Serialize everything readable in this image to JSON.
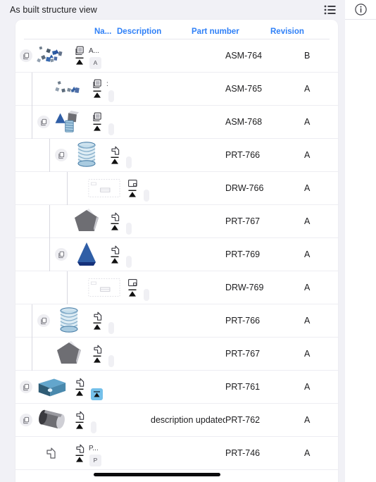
{
  "window": {
    "title": "As built structure view",
    "list_icon": "list-view-icon",
    "info_icon": "info-circle-icon"
  },
  "table": {
    "columns": [
      {
        "key": "name",
        "label": "Na..."
      },
      {
        "key": "desc",
        "label": "Description"
      },
      {
        "key": "part",
        "label": "Part number"
      },
      {
        "key": "revision",
        "label": "Revision"
      }
    ],
    "rows": [
      {
        "depth": 0,
        "thumb": "exploded-assembly-large",
        "type": "assembly-icon",
        "name": "A...",
        "badge": "A",
        "badge_highlight": false,
        "desc": "",
        "part": "ASM-764",
        "revision": "B",
        "expandable": true,
        "has_expand_toggle": true,
        "chevron": "chevron-down-icon"
      },
      {
        "depth": 1,
        "thumb": "exploded-assembly-small",
        "type": "assembly-icon",
        "name": ":",
        "badge": "",
        "badge_highlight": false,
        "desc": "",
        "part": "ASM-765",
        "revision": "A",
        "expandable": true,
        "has_expand_toggle": false,
        "chevron": "chevron-down-icon"
      },
      {
        "depth": 1,
        "thumb": "cone-box-coil-assembly",
        "type": "assembly-icon",
        "name": "",
        "badge": "",
        "badge_highlight": false,
        "desc": "",
        "part": "ASM-768",
        "revision": "A",
        "expandable": true,
        "has_expand_toggle": true,
        "chevron": "chevron-down-icon"
      },
      {
        "depth": 2,
        "thumb": "coil-spring",
        "type": "part-icon",
        "name": "",
        "badge": "",
        "badge_highlight": false,
        "desc": "",
        "part": "PRT-766",
        "revision": "A",
        "expandable": true,
        "has_expand_toggle": true,
        "chevron": "chevron-down-icon"
      },
      {
        "depth": 3,
        "thumb": "drawing-sheet",
        "type": "drawing-icon",
        "name": "",
        "badge": "",
        "badge_highlight": false,
        "desc": "",
        "part": "DRW-766",
        "revision": "A",
        "expandable": false,
        "has_expand_toggle": false,
        "chevron": ""
      },
      {
        "depth": 2,
        "thumb": "grey-pentagon-solid",
        "type": "part-icon",
        "name": "",
        "badge": "",
        "badge_highlight": false,
        "desc": "",
        "part": "PRT-767",
        "revision": "A",
        "expandable": false,
        "has_expand_toggle": false,
        "chevron": ""
      },
      {
        "depth": 2,
        "thumb": "blue-cone",
        "type": "part-icon",
        "name": "",
        "badge": "",
        "badge_highlight": false,
        "desc": "",
        "part": "PRT-769",
        "revision": "A",
        "expandable": true,
        "has_expand_toggle": true,
        "chevron": "chevron-down-icon"
      },
      {
        "depth": 3,
        "thumb": "drawing-sheet",
        "type": "drawing-icon",
        "name": "",
        "badge": "",
        "badge_highlight": false,
        "desc": "",
        "part": "DRW-769",
        "revision": "A",
        "expandable": false,
        "has_expand_toggle": false,
        "chevron": ""
      },
      {
        "depth": 1,
        "thumb": "coil-spring",
        "type": "part-icon",
        "name": "",
        "badge": "",
        "badge_highlight": false,
        "desc": "",
        "part": "PRT-766",
        "revision": "A",
        "expandable": false,
        "has_expand_toggle": true,
        "chevron": ""
      },
      {
        "depth": 1,
        "thumb": "grey-pentagon-solid",
        "type": "part-icon",
        "name": "",
        "badge": "",
        "badge_highlight": false,
        "desc": "",
        "part": "PRT-767",
        "revision": "A",
        "expandable": false,
        "has_expand_toggle": false,
        "chevron": ""
      },
      {
        "depth": 0,
        "thumb": "blue-block",
        "type": "part-icon",
        "name": "",
        "badge": "",
        "badge_highlight": true,
        "desc": "",
        "part": "PRT-761",
        "revision": "A",
        "expandable": false,
        "has_expand_toggle": true,
        "chevron": ""
      },
      {
        "depth": 0,
        "thumb": "grey-cylinder",
        "type": "part-icon",
        "name": "",
        "badge": "",
        "badge_highlight": false,
        "desc": "description updated",
        "part": "PRT-762",
        "revision": "A",
        "expandable": false,
        "has_expand_toggle": true,
        "chevron": ""
      },
      {
        "depth": 0,
        "thumb": "part-icon-plain",
        "type": "part-icon",
        "name": "P...",
        "badge": "P",
        "badge_highlight": false,
        "desc": "",
        "part": "PRT-746",
        "revision": "A",
        "expandable": false,
        "has_expand_toggle": false,
        "chevron": ""
      }
    ]
  }
}
